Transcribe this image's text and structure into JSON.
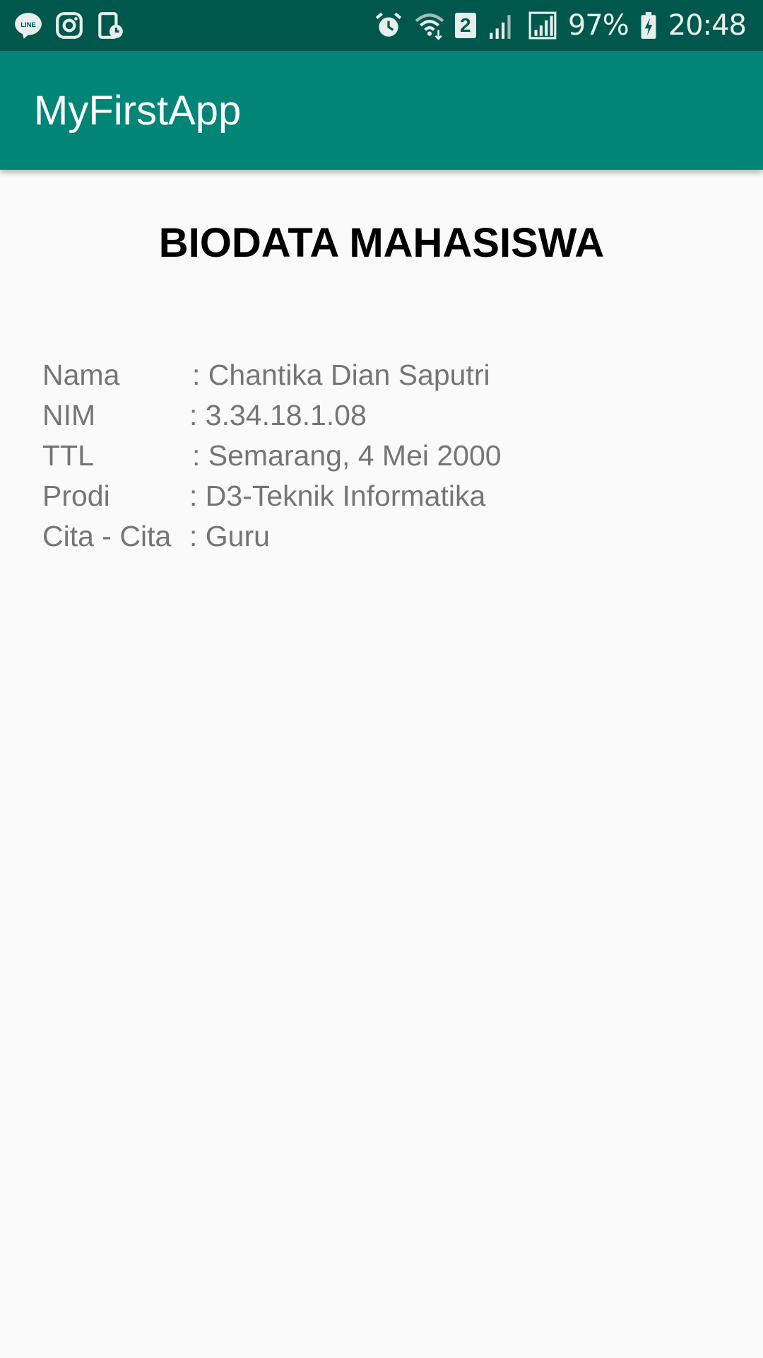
{
  "status_bar": {
    "left_icons": [
      "line-app-icon",
      "instagram-icon",
      "screen-time-icon"
    ],
    "right_icons": [
      "alarm-icon",
      "wifi-icon",
      "sim-2-icon",
      "signal-icon",
      "signal-full-icon",
      "battery-charging-icon"
    ],
    "sim_badge": "2",
    "battery_percent": "97%",
    "time": "20:48",
    "background_color": "#00574b"
  },
  "app_bar": {
    "title": "MyFirstApp",
    "background_color": "#008577"
  },
  "main": {
    "heading": "BIODATA MAHASISWA",
    "rows": [
      {
        "label": "Nama",
        "value": ": Chantika Dian Saputri"
      },
      {
        "label": "NIM",
        "value": ": 3.34.18.1.08"
      },
      {
        "label": "TTL",
        "value": ": Semarang, 4 Mei 2000"
      },
      {
        "label": "Prodi",
        "value": ": D3-Teknik Informatika"
      },
      {
        "label": "Cita - Cita",
        "value": ": Guru"
      }
    ]
  }
}
